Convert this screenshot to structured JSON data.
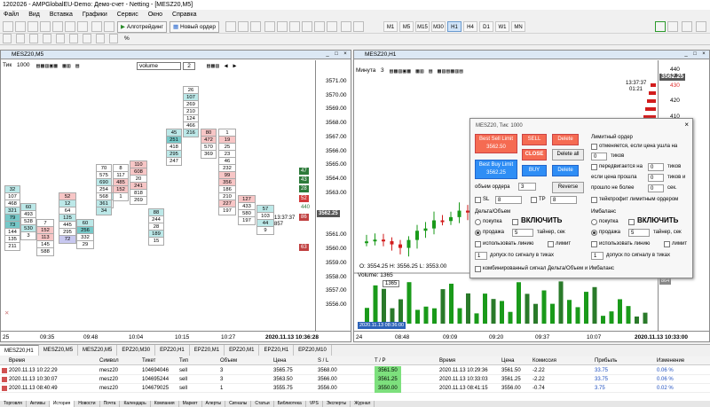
{
  "window": {
    "title": "1202026 - AMPGlobalEU-Demo: Демо-счет - Netting - [MESZ20,M5]"
  },
  "menu": [
    "Файл",
    "Вид",
    "Вставка",
    "Графики",
    "Сервис",
    "Окно",
    "Справка"
  ],
  "toolbar": {
    "algo_label": "Алготрейдинг",
    "neworder_label": "Новый ордер",
    "timeframes": [
      "M1",
      "M5",
      "M15",
      "M30",
      "H1",
      "H4",
      "D1",
      "W1",
      "MN"
    ],
    "active_tf": "H1",
    "zoom_label": "%"
  },
  "left_chart": {
    "title": "MESZ20,M5",
    "tick_label": "Тик",
    "tick_value": "1000",
    "mode_value": "volume",
    "mode_num": "2",
    "prices": [
      "3571.00",
      "3570.00",
      "3569.00",
      "3568.00",
      "3567.00",
      "3566.00",
      "3565.00",
      "3564.00",
      "3563.00",
      "3562.25",
      "3561.00",
      "3560.00",
      "3559.00",
      "3558.00",
      "3557.00",
      "3556.00"
    ],
    "times": [
      "25",
      "09:35",
      "09:48",
      "10:04",
      "10:15",
      "10:27",
      "2020.11.13 10:36:28"
    ],
    "cur_price": "3562.25",
    "countdown": "13:37:37",
    "countdown2": "857",
    "side_vals": [
      "47",
      "43",
      "28",
      "52",
      "440",
      "86",
      "63"
    ],
    "cols": [
      {
        "vals": [
          "32",
          "107",
          "468",
          "321",
          "79",
          "73",
          "144",
          "135",
          "211"
        ],
        "colors": [
          "#bce8e8",
          "#fff",
          "#fff",
          "#bce8e8",
          "#76c8c8",
          "#76c8c8",
          "#fff",
          "#fff",
          "#fff"
        ]
      },
      {
        "vals": [
          "60",
          "493",
          "528",
          "530",
          "3"
        ],
        "colors": [
          "#bce8e8",
          "#fff",
          "#fff",
          "#bce8e8",
          "#fff"
        ]
      },
      {
        "vals": [
          "7",
          "152",
          "113",
          "145",
          "588"
        ],
        "colors": [
          "#fff",
          "#f7c6c6",
          "#f7c6c6",
          "#fff",
          "#fff"
        ]
      },
      {
        "vals": [
          "52",
          "428",
          "288",
          "527",
          "532",
          "117",
          "190"
        ],
        "colors": [
          "#f7c6c6",
          "#fff",
          "#f7c6c6",
          "#fff",
          "#f7c6c6",
          "#fff",
          "#fff"
        ]
      },
      {
        "vals": [
          "12",
          "64",
          "125",
          "445",
          "295",
          "72"
        ],
        "colors": [
          "#bce8e8",
          "#fff",
          "#bce8e8",
          "#fff",
          "#fff",
          "#c8c8f0"
        ]
      },
      {
        "vals": [
          "60",
          "256",
          "332",
          "29"
        ],
        "colors": [
          "#bce8e8",
          "#76c8c8",
          "#fff",
          "#fff"
        ]
      },
      {
        "vals": [
          "539",
          "377",
          "3"
        ],
        "colors": [
          "#f7c6c6",
          "#bce8e8",
          "#fff"
        ]
      },
      {
        "vals": [
          "70",
          "575",
          "690",
          "254",
          "568",
          "361",
          "34"
        ],
        "colors": [
          "#fff",
          "#fff",
          "#bce8e8",
          "#fff",
          "#fff",
          "#bce8e8",
          "#bce8e8"
        ]
      },
      {
        "vals": [
          "8",
          "117",
          "485",
          "152",
          "1"
        ],
        "colors": [
          "#fff",
          "#fff",
          "#f7c6c6",
          "#f7c6c6",
          "#fff"
        ]
      },
      {
        "vals": [
          "110",
          "608",
          "20",
          "241",
          "818",
          "269"
        ],
        "colors": [
          "#f7c6c6",
          "#f7c6c6",
          "#fff",
          "#f7c6c6",
          "#fff",
          "#fff"
        ]
      },
      {
        "vals": [
          "88",
          "244",
          "28",
          "189",
          "15"
        ],
        "colors": [
          "#bce8e8",
          "#fff",
          "#fff",
          "#bce8e8",
          "#fff"
        ]
      },
      {
        "vals": [
          "45",
          "251",
          "418",
          "295",
          "247"
        ],
        "colors": [
          "#bce8e8",
          "#76c8c8",
          "#fff",
          "#bce8e8",
          "#fff"
        ]
      },
      {
        "vals": [
          "26",
          "107",
          "269",
          "210",
          "124",
          "466",
          "216"
        ],
        "colors": [
          "#fff",
          "#bce8e8",
          "#fff",
          "#fff",
          "#fff",
          "#fff",
          "#bce8e8"
        ]
      },
      {
        "vals": [
          "80",
          "472",
          "570",
          "369"
        ],
        "colors": [
          "#f7c6c6",
          "#f7c6c6",
          "#fff",
          "#fff"
        ]
      },
      {
        "vals": [
          "1",
          "19",
          "25",
          "23",
          "46",
          "232",
          "99",
          "356",
          "186",
          "210",
          "227",
          "197"
        ],
        "colors": [
          "#fff",
          "#f7c6c6",
          "#fff",
          "#fff",
          "#fff",
          "#fff",
          "#f7c6c6",
          "#f7c6c6",
          "#fff",
          "#fff",
          "#f7c6c6",
          "#fff"
        ]
      },
      {
        "vals": [
          "127",
          "433",
          "580",
          "197"
        ],
        "colors": [
          "#f7c6c6",
          "#fff",
          "#fff",
          "#fff"
        ]
      },
      {
        "vals": [
          "57",
          "103",
          "44",
          "9"
        ],
        "colors": [
          "#bce8e8",
          "#fff",
          "#bce8e8",
          "#fff"
        ]
      }
    ]
  },
  "right_chart": {
    "title": "MESZ20,H1",
    "label": "Минута",
    "label_num": "3",
    "ohlc": "O: 3554.25  H: 3556.25  L: 3553.00",
    "vol_label": "Volume: 1365",
    "vol_tip": "1365",
    "prices": [
      "440",
      "430",
      "420",
      "410",
      "400",
      "390",
      "380",
      "370",
      "360",
      "350"
    ],
    "cur_price": "3562.25",
    "countdown": "13:37:37",
    "countdown2": "01:21",
    "vol_scale": [
      "1219",
      "864"
    ],
    "times": [
      "24",
      "08:48",
      "09:09",
      "09:20",
      "09:37",
      "10:07",
      "2020.11.13 10:33:00"
    ],
    "sub_time": "2020.11.13 08:36:00"
  },
  "dialog": {
    "title": "MESZ20, Тик: 1000",
    "sell_limit": "Best Sell Limit",
    "sell_limit_price": "3562.50",
    "sell": "SELL",
    "delete1": "Delete",
    "close": "CLOSE",
    "delete_all": "Delete all",
    "buy_limit": "Best Buy Limit",
    "buy_limit_price": "3562.25",
    "buy": "BUY",
    "delete2": "Delete",
    "vol_label": "объем ордера",
    "vol_value": "3",
    "reverse": "Reverse",
    "sl_label": "SL",
    "sl_value": "8",
    "tp_label": "TP",
    "tp_value": "8",
    "limit_hdr": "Лимитный ордер",
    "lim1": "отменяется, если цена ушла на",
    "lim1v": "0",
    "ticks1": "тиков",
    "lim2": "передвигается на",
    "lim2v": "0",
    "ticks2": "тиков",
    "lim3": "если цена прошла",
    "lim3v": "0",
    "ticks3": "тиков и",
    "lim4": "прошло не более",
    "lim4v": "0",
    "sec": "сек.",
    "takeprofit": "тейкпрофит лимитным ордером",
    "delta_hdr": "Дельта/Объем",
    "imb_hdr": "Имбаланс",
    "buy_r": "покупка",
    "sell_r": "продажа",
    "enable": "ВКЛЮЧИТЬ",
    "timer": "тайнер, сек",
    "timer_v": "5",
    "use_line": "использовать линию",
    "limit_w": "лимит",
    "allow": "допуск по сигналу в тиках",
    "allow_v": "1",
    "combined": "комбинированный сигнал Дельта/Объем и Имбаланс"
  },
  "tabs": [
    "MESZ20,H1",
    "MESZ20,M5",
    "MESZ20,M5",
    "EPZ20,M30",
    "EPZ20,H1",
    "EPZ20,M1",
    "EPZ20,M1",
    "EPZ20,H1",
    "EPZ20,M10"
  ],
  "table": {
    "headers": [
      "Время",
      "Символ",
      "Тикет",
      "Тип",
      "Объем",
      "Цена",
      "S / L",
      "T / P",
      "Время",
      "Цена",
      "Комиссия",
      "Прибыль",
      "Изменение"
    ],
    "rows": [
      [
        "2020.11.13 10:22:29",
        "mesz20",
        "104694046",
        "sell",
        "3",
        "3565.75",
        "3568.00",
        "3561.50",
        "2020.11.13 10:29:36",
        "3561.50",
        "-2.22",
        "33.75",
        "0.06 %"
      ],
      [
        "2020.11.13 10:30:07",
        "mesz20",
        "104695244",
        "sell",
        "3",
        "3563.50",
        "3566.00",
        "3561.25",
        "2020.11.13 10:33:03",
        "3561.25",
        "-2.22",
        "33.75",
        "0.06 %"
      ],
      [
        "2020.11.13 08:40:49",
        "mesz20",
        "104679025",
        "sell",
        "1",
        "3555.75",
        "3556.00",
        "3550.00",
        "2020.11.13 08:41:15",
        "3556.00",
        "-0.74",
        "3.75",
        "0.02 %"
      ]
    ]
  },
  "status": [
    "Торговля",
    "Активы",
    "История",
    "Новости",
    "Почта",
    "Календарь",
    "Компания",
    "Маркет",
    "Алерты",
    "Сигналы",
    "Статьи",
    "Библиотека",
    "VPS",
    "Эксперты",
    "Журнал"
  ]
}
